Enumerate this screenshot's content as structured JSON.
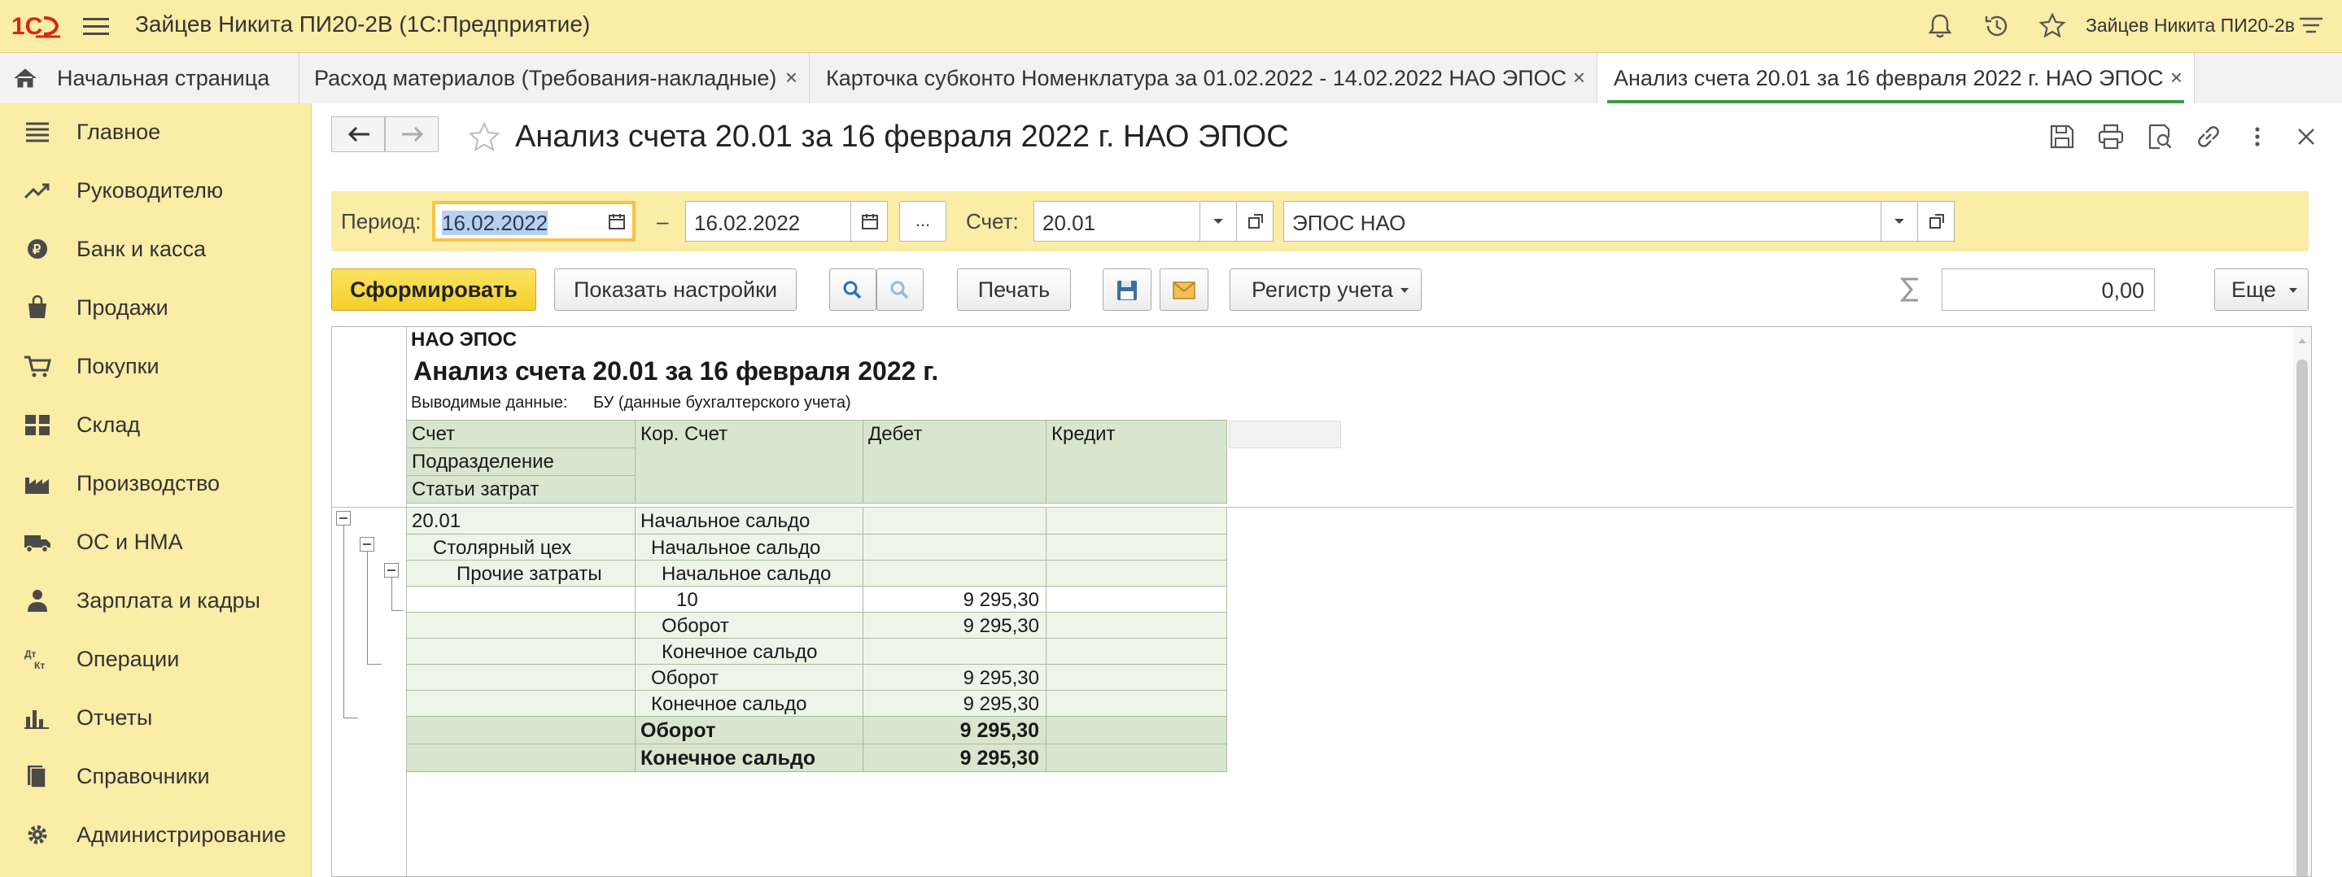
{
  "app": {
    "title": "Зайцев Никита ПИ20-2В  (1С:Предприятие)",
    "user": "Зайцев Никита ПИ20-2в",
    "accent": "#fbeca6"
  },
  "tabs": [
    {
      "label": "Начальная страница"
    },
    {
      "label": "Расход материалов (Требования-накладные)"
    },
    {
      "label": "Карточка субконто Номенклатура за 01.02.2022 - 14.02.2022 НАО ЭПОС"
    },
    {
      "label": "Анализ счета 20.01 за 16 февраля 2022 г. НАО ЭПОС",
      "active": true
    }
  ],
  "close_glyph": "×",
  "sidebar": {
    "items": [
      {
        "label": "Главное",
        "icon": "menu-lines-icon"
      },
      {
        "label": "Руководителю",
        "icon": "trend-icon"
      },
      {
        "label": "Банк и касса",
        "icon": "coin-icon"
      },
      {
        "label": "Продажи",
        "icon": "bag-icon"
      },
      {
        "label": "Покупки",
        "icon": "cart-icon"
      },
      {
        "label": "Склад",
        "icon": "warehouse-icon"
      },
      {
        "label": "Производство",
        "icon": "factory-icon"
      },
      {
        "label": "ОС и НМА",
        "icon": "truck-icon"
      },
      {
        "label": "Зарплата и кадры",
        "icon": "person-icon"
      },
      {
        "label": "Операции",
        "icon": "dt-kt-icon"
      },
      {
        "label": "Отчеты",
        "icon": "bar-chart-icon"
      },
      {
        "label": "Справочники",
        "icon": "books-icon"
      },
      {
        "label": "Администрирование",
        "icon": "gear-icon"
      }
    ]
  },
  "document": {
    "title": "Анализ счета 20.01 за 16 февраля 2022 г. НАО ЭПОС"
  },
  "filters": {
    "period_label": "Период:",
    "date_from": "16.02.2022",
    "dash": "–",
    "date_to": "16.02.2022",
    "more": "...",
    "account_label": "Счет:",
    "account": "20.01",
    "organization": "ЭПОС НАО"
  },
  "commands": {
    "generate": "Сформировать",
    "settings": "Показать настройки",
    "print": "Печать",
    "register": "Регистр учета",
    "sum_value": "0,00",
    "more": "Еще"
  },
  "report": {
    "company": "НАО ЭПОС",
    "title": "Анализ счета 20.01 за 16 февраля 2022 г.",
    "output_label": "Выводимые данные:",
    "output_value": "БУ (данные бухгалтерского учета)",
    "headers": {
      "account": "Счет",
      "division": "Подразделение",
      "cost_items": "Статьи затрат",
      "corr_account": "Кор. Счет",
      "debit": "Дебет",
      "credit": "Кредит"
    },
    "rows": [
      {
        "account": "20.01",
        "corr": "Начальное сальдо",
        "debit": "",
        "credit": ""
      },
      {
        "account": "Столярный цех",
        "corr": "Начальное сальдо",
        "debit": "",
        "credit": ""
      },
      {
        "account": "Прочие затраты",
        "corr": "Начальное сальдо",
        "debit": "",
        "credit": ""
      },
      {
        "account": "",
        "corr": "10",
        "debit": "9 295,30",
        "credit": ""
      },
      {
        "account": "",
        "corr": "Оборот",
        "debit": "9 295,30",
        "credit": ""
      },
      {
        "account": "",
        "corr": "Конечное сальдо",
        "debit": "",
        "credit": ""
      },
      {
        "account": "",
        "corr": "Оборот",
        "debit": "9 295,30",
        "credit": ""
      },
      {
        "account": "",
        "corr": "Конечное сальдо",
        "debit": "9 295,30",
        "credit": ""
      },
      {
        "account": "",
        "corr": "Оборот",
        "debit": "9 295,30",
        "credit": "",
        "bold": true
      },
      {
        "account": "",
        "corr": "Конечное сальдо",
        "debit": "9 295,30",
        "credit": "",
        "bold": true
      }
    ]
  }
}
